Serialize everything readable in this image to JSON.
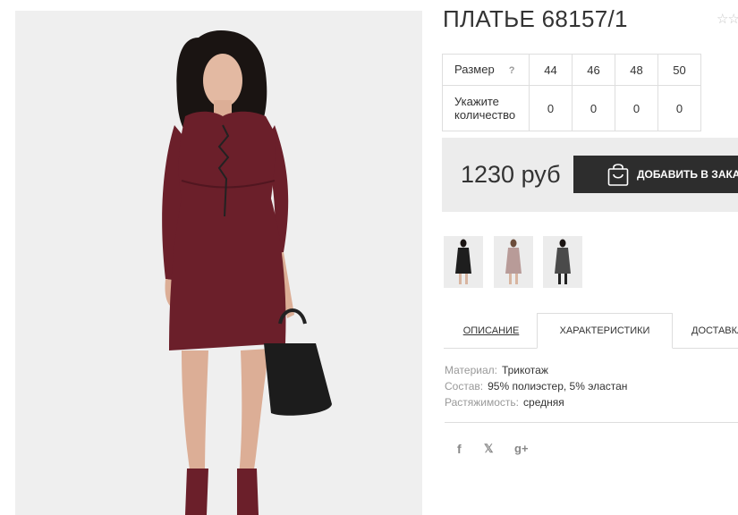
{
  "product": {
    "title": "ПЛАТЬЕ 68157/1",
    "rating_stars": "☆☆",
    "price": "1230 руб",
    "add_to_cart_label": "ДОБАВИТЬ В ЗАКАЗ"
  },
  "size_table": {
    "size_label": "Размер",
    "help_icon": "?",
    "sizes": [
      "44",
      "46",
      "48",
      "50"
    ],
    "quantity_label_line1": "Укажите",
    "quantity_label_line2": "количество",
    "quantities": [
      "0",
      "0",
      "0",
      "0"
    ]
  },
  "thumbnails": [
    {
      "name": "black-dress-thumb",
      "color": "#1e1e1e"
    },
    {
      "name": "pink-dress-thumb",
      "color": "#b89b98"
    },
    {
      "name": "grey-dress-thumb",
      "color": "#4a4a4a"
    }
  ],
  "tabs": {
    "description": "ОПИСАНИЕ",
    "characteristics": "ХАРАКТЕРИСТИКИ",
    "delivery": "ДОСТАВКА"
  },
  "specs": [
    {
      "key": "Материал:",
      "value": "Трикотаж"
    },
    {
      "key": "Состав:",
      "value": "95% полиэстер, 5% эластан"
    },
    {
      "key": "Растяжимость:",
      "value": "средняя"
    }
  ],
  "social": {
    "facebook": "f",
    "twitter": "𝕏",
    "google_plus": "g+"
  },
  "colors": {
    "dress": "#6b1f2a",
    "button_bg": "#2d2d2d",
    "price_bg": "#ececec"
  }
}
